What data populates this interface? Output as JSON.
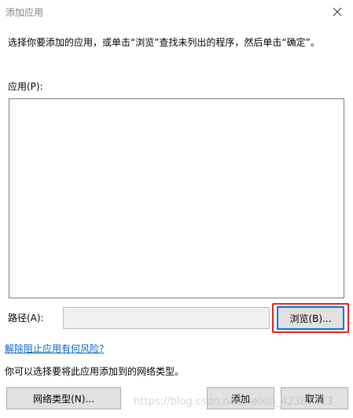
{
  "window": {
    "title": "添加应用",
    "close_icon": "close-icon"
  },
  "instruction": "选择你要添加的应用，或单击“浏览”查找未列出的程序，然后单击“确定”。",
  "apps": {
    "label": "应用(P):",
    "items": []
  },
  "path": {
    "label": "路径(A):",
    "value": "",
    "browse_label": "浏览(B)..."
  },
  "risk_link": "解除阻止应用有何风险?",
  "network_info": "你可以选择要将此应用添加到的网络类型。",
  "buttons": {
    "network_types": "网络类型(N)...",
    "add": "添加",
    "cancel": "取消"
  },
  "watermark": "https://blog.csdn.net/weixin_42367713",
  "colors": {
    "highlight_border": "#e8211d",
    "link": "#0066cc",
    "focus_border": "#0078d7",
    "button_bg": "#e1e1e1"
  }
}
